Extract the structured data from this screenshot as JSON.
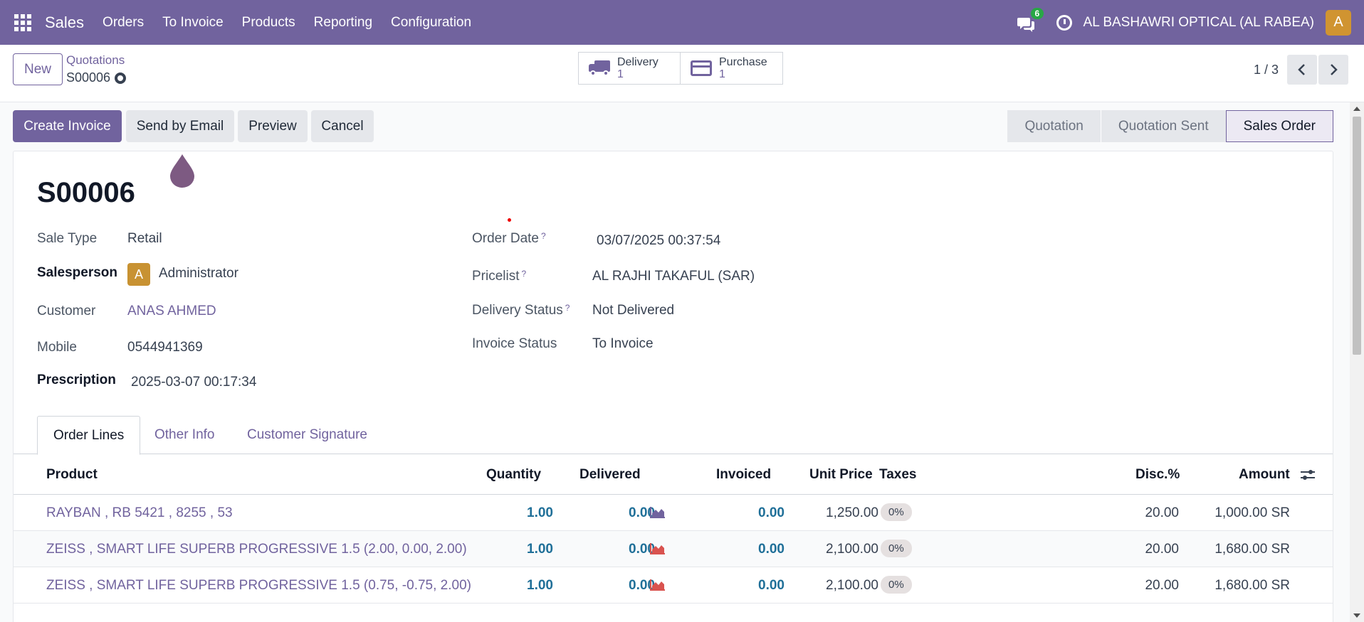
{
  "navbar": {
    "app_name": "Sales",
    "menu": [
      "Orders",
      "To Invoice",
      "Products",
      "Reporting",
      "Configuration"
    ],
    "chat_count": "6",
    "company": "AL BASHAWRI OPTICAL (AL RABEA)",
    "user_initial": "A"
  },
  "control": {
    "new_label": "New",
    "breadcrumb_parent": "Quotations",
    "breadcrumb_current": "S00006",
    "smart_buttons": [
      {
        "label": "Delivery",
        "count": "1",
        "icon": "truck-icon"
      },
      {
        "label": "Purchase",
        "count": "1",
        "icon": "credit-card-icon"
      }
    ],
    "pager": "1 / 3"
  },
  "actions": {
    "create_invoice": "Create Invoice",
    "send_email": "Send by Email",
    "preview": "Preview",
    "cancel": "Cancel"
  },
  "status_stages": [
    "Quotation",
    "Quotation Sent",
    "Sales Order"
  ],
  "status_active": "Sales Order",
  "record": {
    "name": "S00006",
    "sale_type_label": "Sale Type",
    "sale_type": "Retail",
    "salesperson_label": "Salesperson",
    "salesperson_initial": "A",
    "salesperson": "Administrator",
    "customer_label": "Customer",
    "customer": "ANAS AHMED",
    "mobile_label": "Mobile",
    "mobile": "0544941369",
    "prescription_label": "Prescription",
    "prescription": "2025-03-07 00:17:34",
    "order_date_label": "Order Date",
    "order_date": "03/07/2025 00:37:54",
    "pricelist_label": "Pricelist",
    "pricelist": "AL RAJHI TAKAFUL (SAR)",
    "delivery_status_label": "Delivery Status",
    "delivery_status": "Not Delivered",
    "invoice_status_label": "Invoice Status",
    "invoice_status": "To Invoice",
    "help_mark": "?"
  },
  "tabs": [
    "Order Lines",
    "Other Info",
    "Customer Signature"
  ],
  "table": {
    "headers": {
      "product": "Product",
      "quantity": "Quantity",
      "delivered": "Delivered",
      "invoiced": "Invoiced",
      "unit_price": "Unit Price",
      "taxes": "Taxes",
      "disc": "Disc.%",
      "amount": "Amount"
    },
    "rows": [
      {
        "product": "RAYBAN , RB 5421 , 8255 , 53",
        "quantity": "1.00",
        "delivered": "0.00",
        "forecast_color": "#71639e",
        "invoiced": "0.00",
        "unit_price": "1,250.00",
        "taxes": "0%",
        "disc": "20.00",
        "amount": "1,000.00 SR"
      },
      {
        "product": "ZEISS , SMART LIFE SUPERB PROGRESSIVE 1.5 (2.00, 0.00, 2.00)",
        "quantity": "1.00",
        "delivered": "0.00",
        "forecast_color": "#d9534f",
        "invoiced": "0.00",
        "unit_price": "2,100.00",
        "taxes": "0%",
        "disc": "20.00",
        "amount": "1,680.00 SR"
      },
      {
        "product": "ZEISS , SMART LIFE SUPERB PROGRESSIVE 1.5 (0.75, -0.75, 2.00)",
        "quantity": "1.00",
        "delivered": "0.00",
        "forecast_color": "#d9534f",
        "invoiced": "0.00",
        "unit_price": "2,100.00",
        "taxes": "0%",
        "disc": "20.00",
        "amount": "1,680.00 SR"
      }
    ]
  },
  "colors": {
    "brand": "#71639e",
    "avatar": "#d09431",
    "badge": "#28a745",
    "number": "#1f6f98"
  }
}
